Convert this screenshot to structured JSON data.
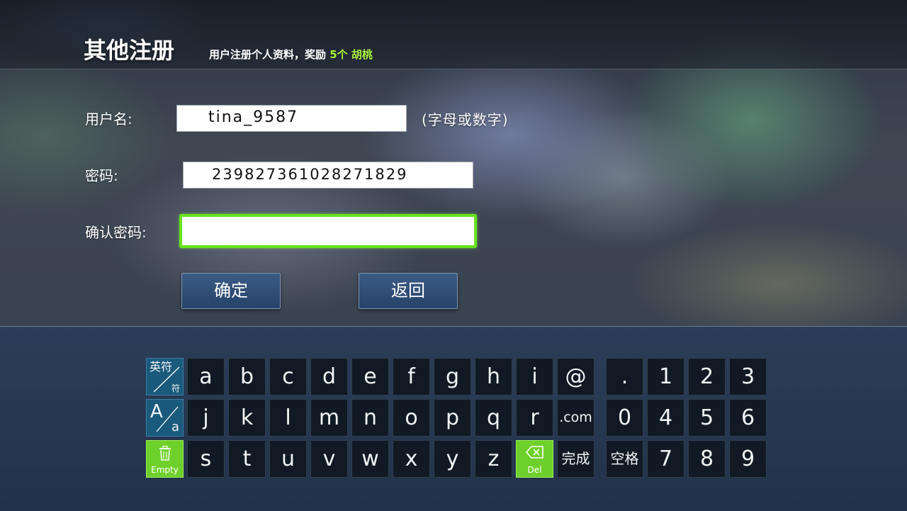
{
  "header": {
    "title": "其他注册",
    "subtitle_prefix": "用户注册个人资料，奖励 ",
    "subtitle_highlight": "5个 胡桃"
  },
  "form": {
    "username_label": "用户名:",
    "username_value": "tina_9587",
    "username_hint": "(字母或数字)",
    "password_label": "密码:",
    "password_value": "239827361028271829",
    "confirm_label": "确认密码:",
    "confirm_value": ""
  },
  "buttons": {
    "confirm": "确定",
    "back": "返回"
  },
  "keyboard": {
    "switch_key": {
      "top": "英符",
      "bottom": "符"
    },
    "case_key": {
      "top": "A",
      "bottom": "a"
    },
    "empty_key": "Empty",
    "del_key": "Del",
    "row1": [
      "a",
      "b",
      "c",
      "d",
      "e",
      "f",
      "g",
      "h",
      "i",
      "@"
    ],
    "row2": [
      "j",
      "k",
      "l",
      "m",
      "n",
      "o",
      "p",
      "q",
      "r",
      ".com"
    ],
    "row3": [
      "s",
      "t",
      "u",
      "v",
      "w",
      "x",
      "y",
      "z"
    ],
    "done": "完成",
    "space": "空格",
    "num_row1": [
      ".",
      "1",
      "2",
      "3"
    ],
    "num_row2": [
      "0",
      "4",
      "5",
      "6"
    ],
    "num_row3": [
      "7",
      "8",
      "9"
    ]
  },
  "colors": {
    "accent_green": "#66e31f",
    "button_blue": "#2f4f78",
    "key_bg": "#111a24",
    "key_blue": "#1a5a7c"
  }
}
